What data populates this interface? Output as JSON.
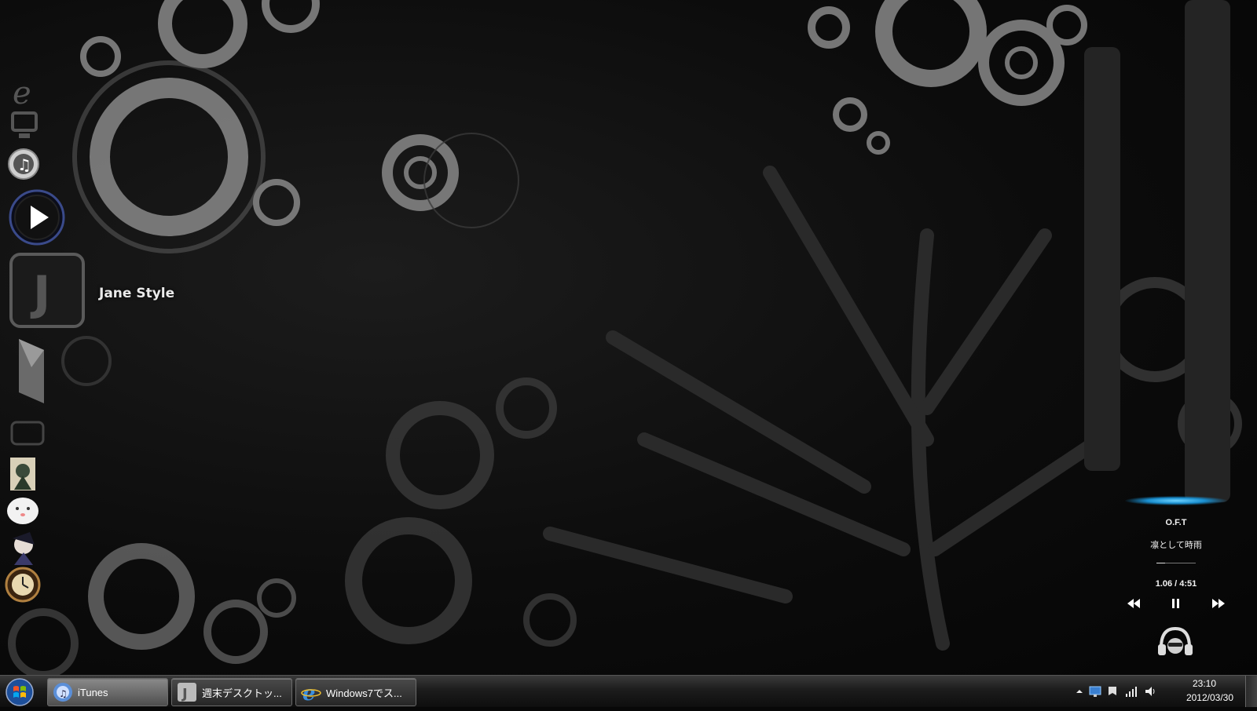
{
  "desktop": {
    "wallpaper": "dark-grunge-circles-bamboo",
    "dock_icons": [
      {
        "name": "ie-icon"
      },
      {
        "name": "computer-icon"
      },
      {
        "name": "itunes-icon"
      },
      {
        "name": "media-play-icon"
      },
      {
        "name": "jane-style-icon"
      },
      {
        "name": "folder-icon"
      },
      {
        "name": "recycle-bin-icon"
      },
      {
        "name": "character-card-icon"
      },
      {
        "name": "cute-face-icon"
      },
      {
        "name": "anime-character-icon"
      },
      {
        "name": "clock-gadget-icon"
      }
    ],
    "jane_label": "Jane Style"
  },
  "media_widget": {
    "artist": "O.F.T",
    "track": "凛として時雨",
    "time": "1.06 / 4:51",
    "progress_fraction": 0.22,
    "prev_icon": "rewind-icon",
    "pause_icon": "pause-icon",
    "next_icon": "fast-forward-icon",
    "glow_color": "#1a8fd0"
  },
  "taskbar": {
    "start_icon": "windows-start-orb",
    "tasks": [
      {
        "label": "iTunes",
        "icon": "itunes-icon",
        "active": true
      },
      {
        "label": "週末デスクトッ...",
        "icon": "jane-style-icon",
        "active": false
      },
      {
        "label": "Windows7でス...",
        "icon": "ie-icon",
        "active": false
      }
    ],
    "tray": {
      "chevron_icon": "show-hidden-icons-chevron",
      "icons": [
        "display-icon",
        "action-center-icon",
        "network-signal-icon",
        "volume-icon"
      ],
      "clock_time": "23:10",
      "clock_date": "2012/03/30"
    }
  }
}
